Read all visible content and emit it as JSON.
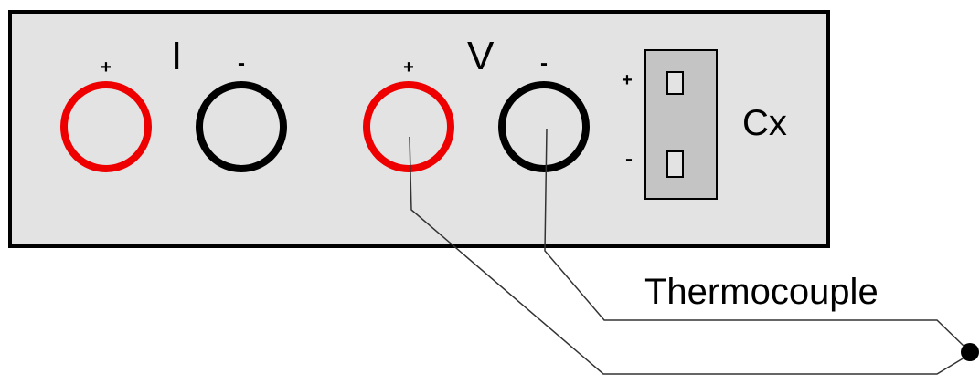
{
  "panel": {
    "current_label": "I",
    "voltage_label": "V",
    "cx_label": "Cx",
    "current_plus": "+",
    "current_minus": "-",
    "voltage_plus": "+",
    "voltage_minus": "-",
    "cx_plus": "+",
    "cx_minus": "-"
  },
  "thermocouple": {
    "label": "Thermocouple"
  },
  "colors": {
    "panel_fill": "#e3e3e3",
    "panel_stroke": "#000000",
    "positive_terminal": "#ee0000",
    "negative_terminal": "#000000",
    "connector_fill": "#c4c4c4",
    "wire": "#333333",
    "background": "#ffffff"
  }
}
